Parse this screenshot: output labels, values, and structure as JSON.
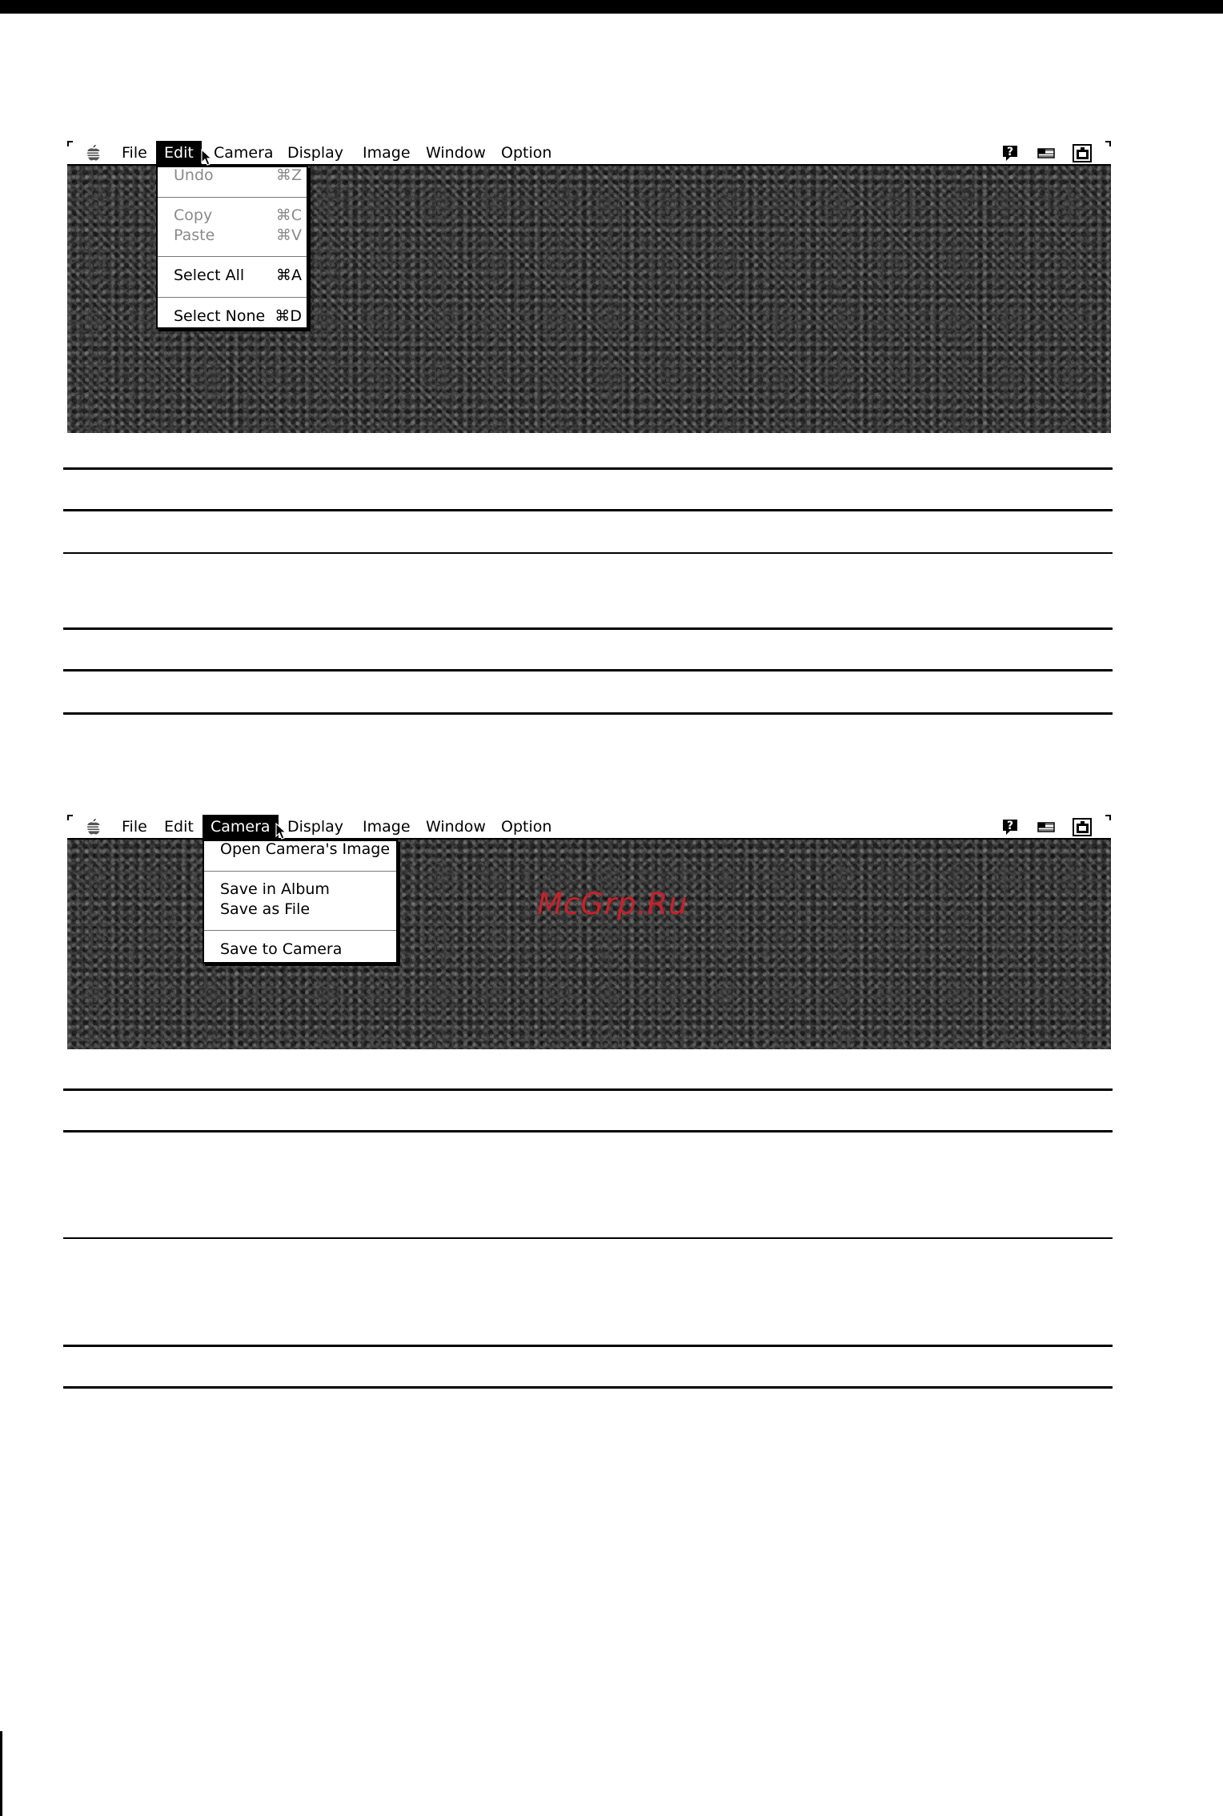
{
  "menubar": {
    "items": [
      "File",
      "Edit",
      "Camera",
      "Display",
      "Image",
      "Window",
      "Option"
    ],
    "icons": [
      "apple-icon",
      "help-icon",
      "keyboard-icon",
      "application-icon"
    ]
  },
  "screen1": {
    "active_menu": "Edit",
    "edit_menu": {
      "undo": {
        "label": "Undo",
        "key": "⌘Z",
        "enabled": false
      },
      "copy": {
        "label": "Copy",
        "key": "⌘C",
        "enabled": false
      },
      "paste": {
        "label": "Paste",
        "key": "⌘V",
        "enabled": false
      },
      "select_all": {
        "label": "Select All",
        "key": "⌘A",
        "enabled": true
      },
      "select_none": {
        "label": "Select None",
        "key": "⌘D",
        "enabled": true
      }
    }
  },
  "screen2": {
    "active_menu": "Camera",
    "camera_menu": {
      "open_image": "Open Camera's Image",
      "save_album": "Save in Album",
      "save_file": "Save as File",
      "save_camera": "Save to Camera"
    },
    "watermark": "McGrp.Ru"
  },
  "colors": {
    "desktop": "#3b3b3b",
    "watermark": "#c8202a",
    "disabled_text": "#8a8a8a"
  }
}
